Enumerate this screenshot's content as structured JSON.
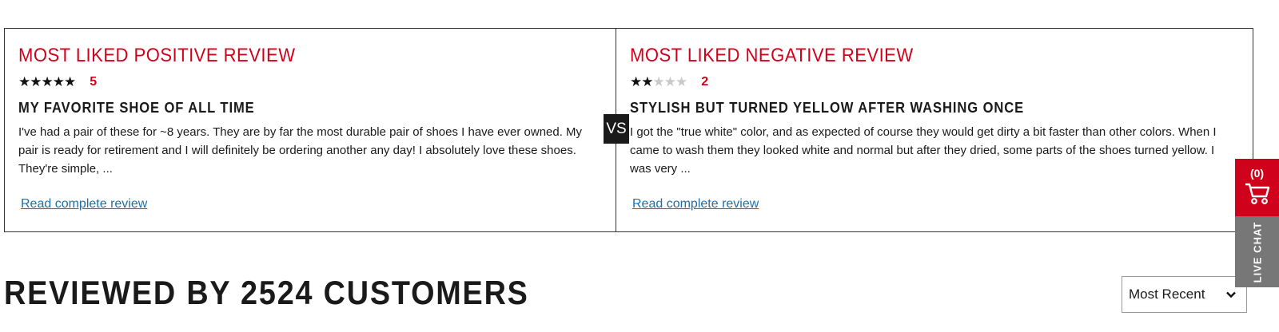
{
  "positive": {
    "heading": "MOST LIKED POSITIVE REVIEW",
    "stars_filled": 5,
    "stars_total": 5,
    "rating": "5",
    "title": "MY FAVORITE SHOE OF ALL TIME",
    "body": "I've had a pair of these for ~8 years. They are by far the most durable pair of shoes I have ever owned. My pair is ready for retirement and I will definitely be ordering another any day! I absolutely love these shoes. They're simple, ...",
    "link": "Read complete review"
  },
  "negative": {
    "heading": "MOST LIKED NEGATIVE REVIEW",
    "stars_filled": 2,
    "stars_total": 5,
    "rating": "2",
    "title": "STYLISH BUT TURNED YELLOW AFTER WASHING ONCE",
    "body": "I got the \"true white\" color, and as expected of course they would get dirty a bit faster than other colors. When I came to wash them they looked white and normal but after they dried, some parts of the shoes turned yellow. I was very ...",
    "link": "Read complete review"
  },
  "vs_label": "VS",
  "reviews_heading": "REVIEWED BY 2524 CUSTOMERS",
  "sort": {
    "selected": "Most Recent"
  },
  "side": {
    "cart_count": "(0)",
    "chat_label": "LIVE CHAT"
  },
  "colors": {
    "accent": "#d0021b",
    "link": "#1f6fa8",
    "chat_bg": "#777777"
  }
}
